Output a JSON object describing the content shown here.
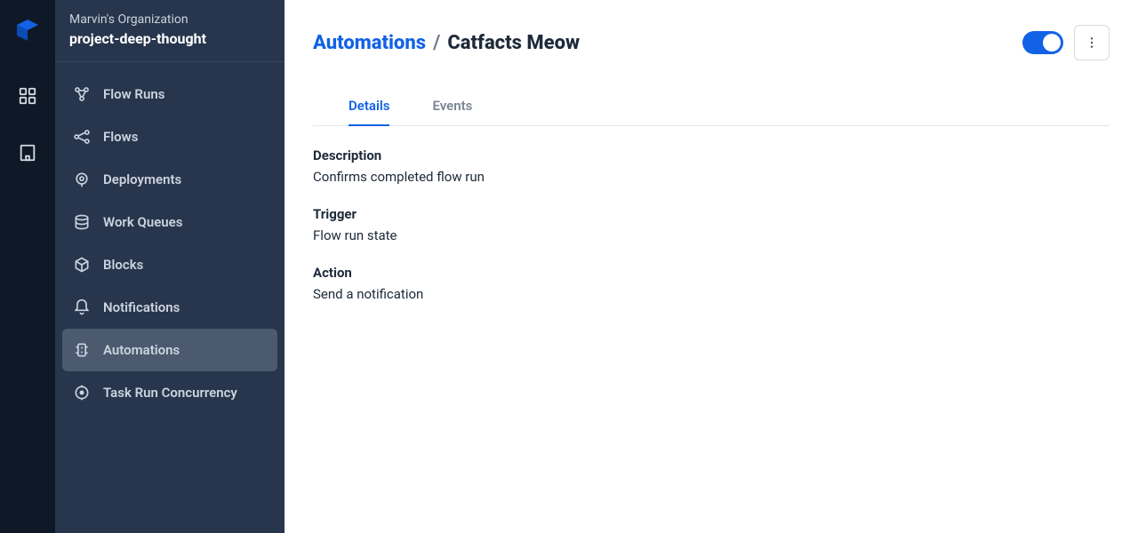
{
  "workspace": {
    "organization": "Marvin's Organization",
    "project": "project-deep-thought"
  },
  "sidebar": {
    "items": [
      {
        "label": "Flow Runs",
        "icon": "flow-runs-icon",
        "active": false
      },
      {
        "label": "Flows",
        "icon": "flows-icon",
        "active": false
      },
      {
        "label": "Deployments",
        "icon": "deployments-icon",
        "active": false
      },
      {
        "label": "Work Queues",
        "icon": "work-queues-icon",
        "active": false
      },
      {
        "label": "Blocks",
        "icon": "blocks-icon",
        "active": false
      },
      {
        "label": "Notifications",
        "icon": "notifications-icon",
        "active": false
      },
      {
        "label": "Automations",
        "icon": "automations-icon",
        "active": true
      },
      {
        "label": "Task Run Concurrency",
        "icon": "concurrency-icon",
        "active": false
      }
    ]
  },
  "breadcrumb": {
    "parent": "Automations",
    "separator": "/",
    "current": "Catfacts Meow"
  },
  "toggle": {
    "enabled": true
  },
  "tabs": [
    {
      "label": "Details",
      "active": true
    },
    {
      "label": "Events",
      "active": false
    }
  ],
  "details": {
    "description_label": "Description",
    "description_value": "Confirms completed flow run",
    "trigger_label": "Trigger",
    "trigger_value": "Flow run state",
    "action_label": "Action",
    "action_value": "Send a notification"
  },
  "colors": {
    "accent": "#1262e6",
    "sidebar_bg": "#27364c",
    "rail_bg": "#0f1826"
  }
}
